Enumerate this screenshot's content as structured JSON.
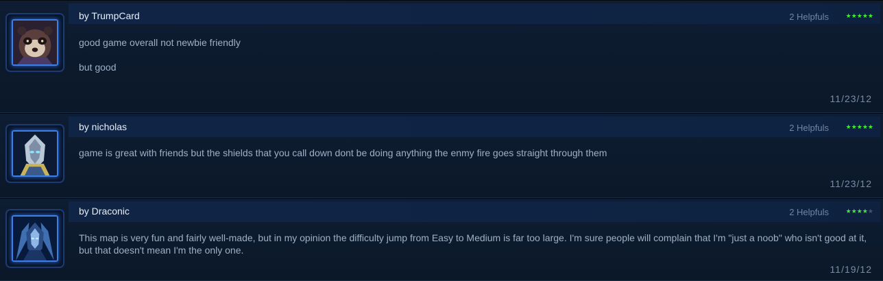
{
  "reviews": [
    {
      "author": "by TrumpCard",
      "helpfuls": "2 Helpfuls",
      "rating": 5,
      "body": [
        "good game overall not newbie friendly",
        "but good"
      ],
      "date": "11/23/12",
      "avatar_icon": "panda-monk-portrait-icon"
    },
    {
      "author": "by nicholas",
      "helpfuls": "2 Helpfuls",
      "rating": 5,
      "body": [
        "game is great with friends but the shields that you call down dont be doing anything the enmy fire goes straight through them"
      ],
      "date": "11/23/12",
      "avatar_icon": "protoss-templar-portrait-icon"
    },
    {
      "author": "by Draconic",
      "helpfuls": "2 Helpfuls",
      "rating": 4,
      "body": [
        "This map is very fun and fairly well-made, but in my opinion the difficulty jump from Easy to Medium is far too large. I'm sure people will complain that I'm \"just a noob\" who isn't good at it, but that doesn't mean I'm the only one."
      ],
      "date": "11/19/12",
      "avatar_icon": "dark-templar-portrait-icon"
    }
  ],
  "colors": {
    "star_on": "#44e83a",
    "star_off": "#4a5668",
    "frame_glow": "#3d7ee8"
  }
}
